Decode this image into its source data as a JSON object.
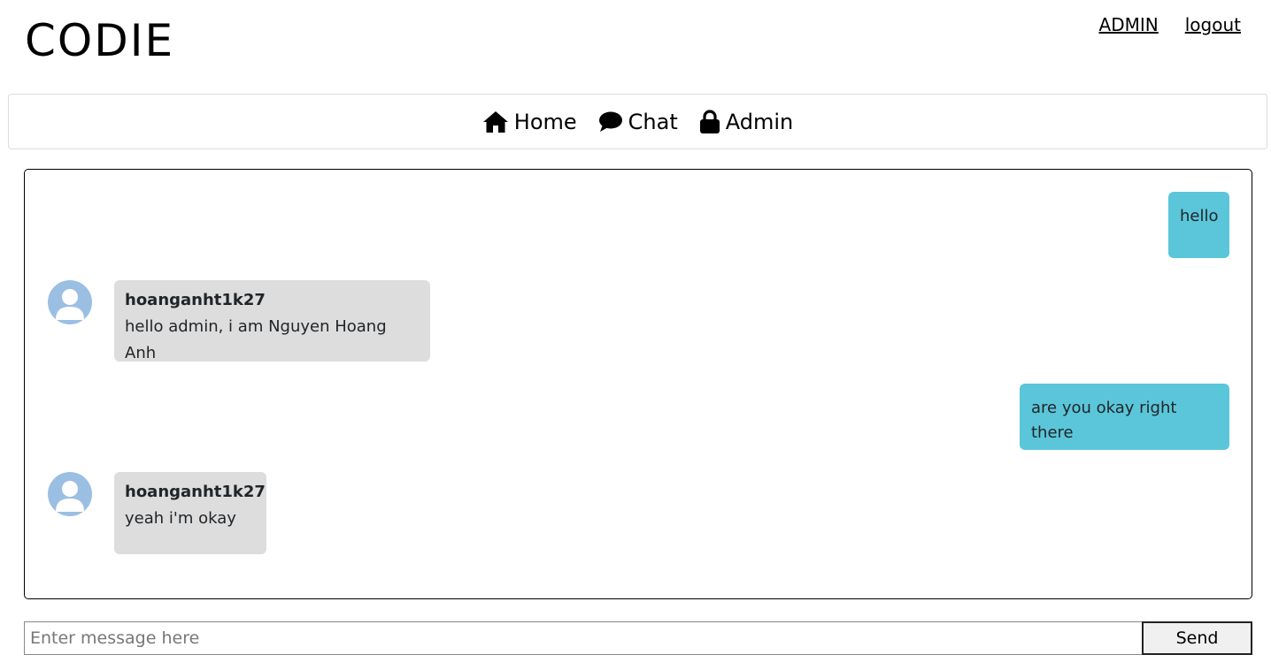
{
  "app": {
    "logo": "CODIE"
  },
  "header": {
    "user_link": "ADMIN",
    "logout_link": "logout"
  },
  "navbar": {
    "items": [
      {
        "label": "Home",
        "icon": "home-icon"
      },
      {
        "label": "Chat",
        "icon": "chat-bubble-icon"
      },
      {
        "label": "Admin",
        "icon": "lock-icon"
      }
    ]
  },
  "chat": {
    "messages": [
      {
        "direction": "outgoing",
        "text": "hello"
      },
      {
        "direction": "incoming",
        "sender": "hoanganht1k27",
        "text": "hello admin, i am Nguyen Hoang Anh",
        "avatar": "user-avatar-icon"
      },
      {
        "direction": "outgoing",
        "text": "are you okay right there"
      },
      {
        "direction": "incoming",
        "sender": "hoanganht1k27",
        "text": "yeah i'm okay",
        "avatar": "user-avatar-icon"
      }
    ]
  },
  "composer": {
    "placeholder": "Enter message here",
    "value": "",
    "send_label": "Send"
  },
  "colors": {
    "outgoing_bubble": "#5bc6d9",
    "incoming_bubble": "#dddddd",
    "avatar": "#9bbfe3"
  }
}
